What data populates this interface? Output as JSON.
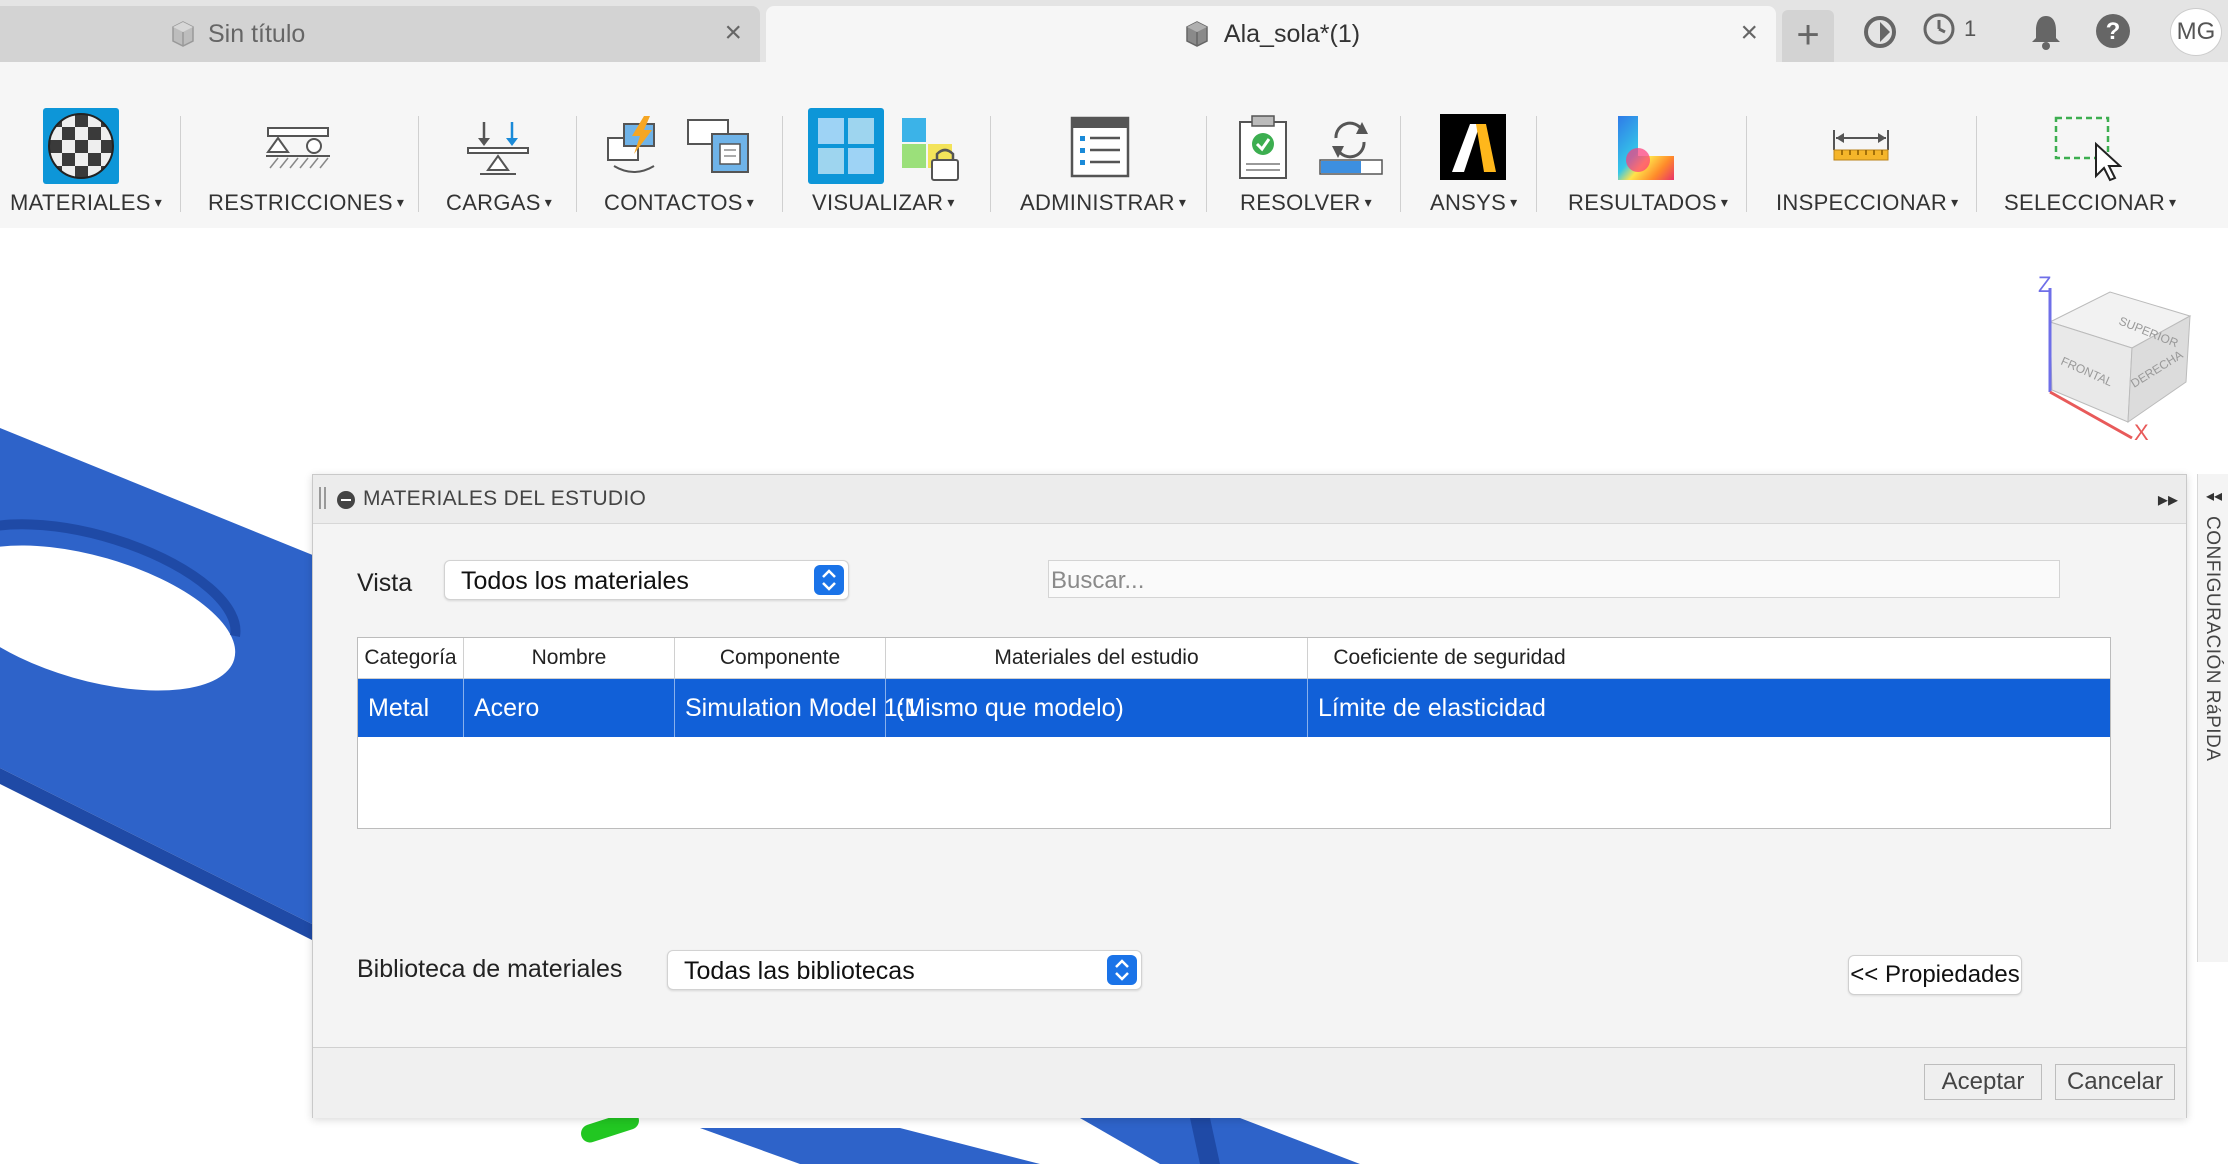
{
  "tabs": [
    {
      "title": "Sin título",
      "close": "×"
    },
    {
      "title": "Ala_sola*(1)",
      "close": "×"
    }
  ],
  "titlebar": {
    "new_tab": "+",
    "jobs_count": "1",
    "user_initials": "MG"
  },
  "ribbon": {
    "groups": [
      {
        "label": "MATERIALES",
        "icon": "material-sphere-icon"
      },
      {
        "label": "RESTRICCIONES",
        "icon": "constraints-icon"
      },
      {
        "label": "CARGAS",
        "icon": "loads-icon"
      },
      {
        "label": "CONTACTOS",
        "icon": "contacts-icon"
      },
      {
        "label": "VISUALIZAR",
        "icon": "display-icon"
      },
      {
        "label": "ADMINISTRAR",
        "icon": "manage-icon"
      },
      {
        "label": "RESOLVER",
        "icon": "solve-icon"
      },
      {
        "label": "ANSYS",
        "icon": "ansys-logo-icon"
      },
      {
        "label": "RESULTADOS",
        "icon": "results-icon"
      },
      {
        "label": "INSPECCIONAR",
        "icon": "measure-icon"
      },
      {
        "label": "SELECCIONAR",
        "icon": "select-icon"
      }
    ],
    "dropdown_arrow": "▾"
  },
  "viewcube": {
    "faces": [
      "SUPERIOR",
      "FRONTAL",
      "DERECHA"
    ],
    "axes": [
      "Z",
      "X"
    ]
  },
  "dialog": {
    "title": "MATERIALES DEL ESTUDIO",
    "expand": "▸▸",
    "vista_label": "Vista",
    "vista_value": "Todos los materiales",
    "search_placeholder": "Buscar...",
    "table": {
      "headers": [
        "Categoría",
        "Nombre",
        "Componente",
        "Materiales del estudio",
        "Coeficiente de seguridad"
      ],
      "rows": [
        [
          "Metal",
          "Acero",
          "Simulation Model 1:1",
          "(Mismo que modelo)",
          "Límite de elasticidad"
        ]
      ]
    },
    "library_label": "Biblioteca de materiales",
    "library_value": "Todas las bibliotecas",
    "properties_button": "<< Propiedades",
    "ok_button": "Aceptar",
    "cancel_button": "Cancelar"
  },
  "side_panel": {
    "arrow": "◂◂",
    "label": "CONFIGURACIÓN RáPIDA"
  },
  "colors": {
    "model_blue": "#2e63c9",
    "selection_blue": "#1160d8",
    "accent_blue": "#0d96d8"
  }
}
